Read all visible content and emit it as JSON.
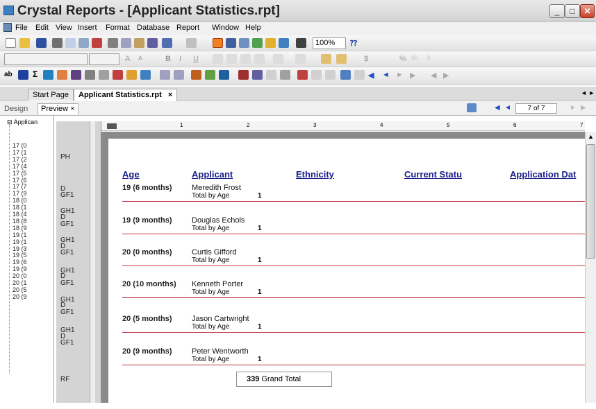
{
  "window": {
    "title": "Crystal Reports - [Applicant Statistics.rpt]",
    "min": "_",
    "max": "□",
    "close": "✕"
  },
  "menu": [
    "File",
    "Edit",
    "View",
    "Insert",
    "Format",
    "Database",
    "Report",
    "Window",
    "Help"
  ],
  "toolbar": {
    "zoom": "100%",
    "font_btns": [
      "A",
      "A",
      "B",
      "I",
      "U"
    ],
    "currency": "$",
    "percent": "%",
    "decimals_more": ".00",
    "decimals_less": ".0"
  },
  "tabs": {
    "start": "Start Page",
    "active": "Applicant Statistics.rpt",
    "close": "×",
    "nav": "◄ ►"
  },
  "view": {
    "design": "Design",
    "preview": "Preview",
    "close": "×",
    "page": "7 of 7"
  },
  "tree": {
    "root": "Applican",
    "items": [
      "17 (0",
      "17 (1",
      "17 (2",
      "17 (4",
      "17 (5",
      "17 (6",
      "17 (7",
      "17 (9",
      "18 (0",
      "18 (1",
      "18 (4",
      "18 (8",
      "18 (9",
      "19 (1",
      "19 (1",
      "19 (3",
      "19 (5",
      "19 (6",
      "19 (9",
      "20 (0",
      "20 (1",
      "20 (5",
      "20 (9"
    ]
  },
  "sections": [
    "PH",
    "D",
    "GF1",
    "GH1",
    "D",
    "GF1",
    "GH1",
    "D",
    "GF1",
    "GH1",
    "D",
    "GF1",
    "GH1",
    "D",
    "GF1",
    "GH1",
    "D",
    "GF1",
    "RF"
  ],
  "ruler": [
    "1",
    "2",
    "3",
    "4",
    "5",
    "6",
    "7"
  ],
  "report": {
    "headers": [
      "Age",
      "Applicant",
      "Ethnicity",
      "Current Statu",
      "Application Dat"
    ],
    "total_label": "Total by Age",
    "groups": [
      {
        "age": "19 (6 months)",
        "applicant": "Meredith Frost",
        "count": "1"
      },
      {
        "age": "19 (9 months)",
        "applicant": "Douglas Echols",
        "count": "1"
      },
      {
        "age": "20 (0 months)",
        "applicant": "Curtis Gifford",
        "count": "1"
      },
      {
        "age": "20 (10 months)",
        "applicant": "Kenneth Porter",
        "count": "1"
      },
      {
        "age": "20 (5 months)",
        "applicant": "Jason Cartwright",
        "count": "1"
      },
      {
        "age": "20 (9 months)",
        "applicant": "Peter Wentworth",
        "count": "1"
      }
    ],
    "grand_total": {
      "value": "339",
      "label": "Grand Total"
    }
  },
  "colors": {
    "header": "#1a1f8a",
    "rule": "#c0303a"
  }
}
